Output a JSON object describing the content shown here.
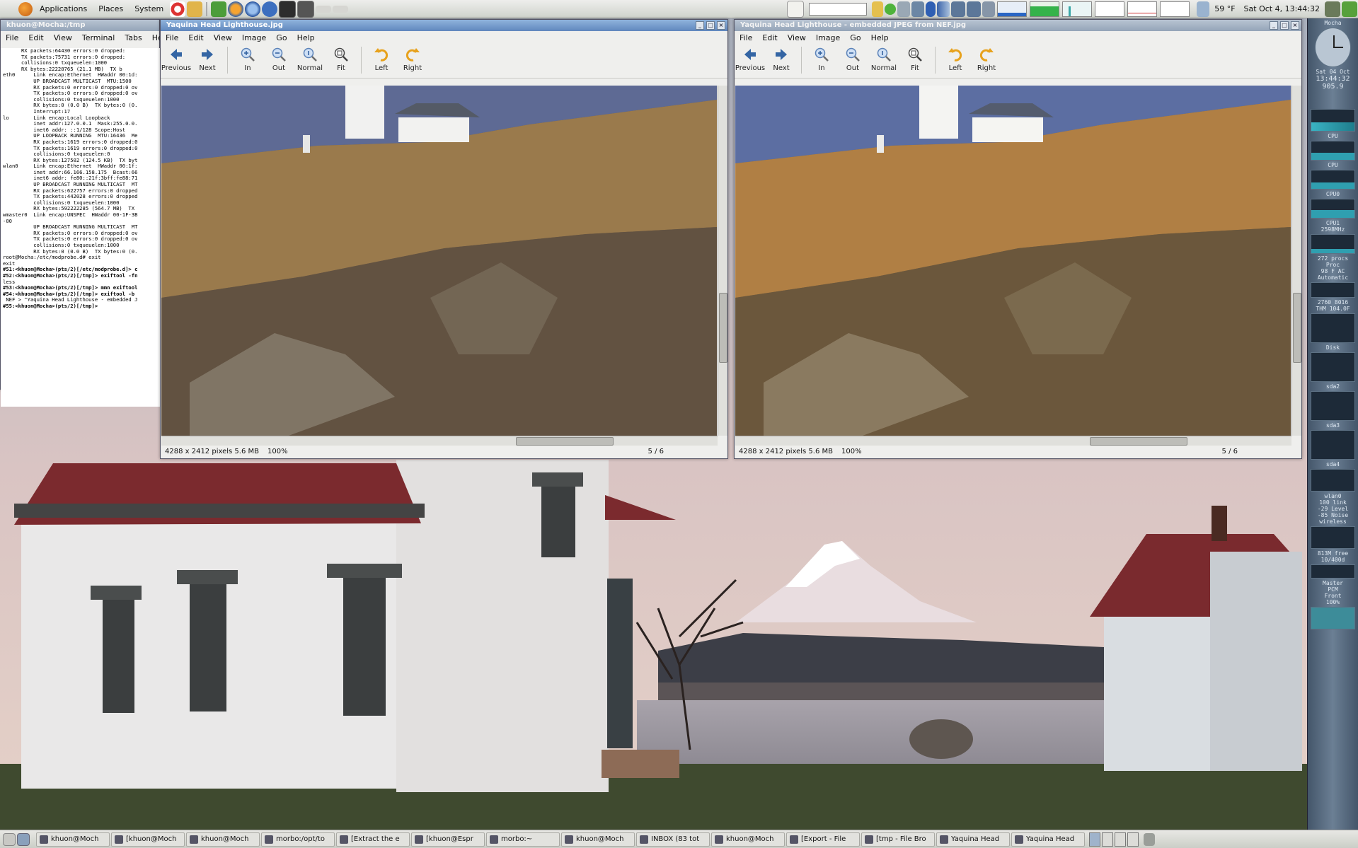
{
  "top_panel": {
    "menus": [
      "Applications",
      "Places",
      "System"
    ],
    "weather": "59 °F",
    "clock": "Sat Oct  4, 13:44:32"
  },
  "terminal": {
    "title": "khuon@Mocha:/tmp",
    "menus": [
      "File",
      "Edit",
      "View",
      "Terminal",
      "Tabs",
      "Help"
    ],
    "lines": [
      "      RX packets:64430 errors:0 dropped:",
      "      TX packets:75731 errors:0 dropped:",
      "      collisions:0 txqueuelen:1000",
      "      RX bytes:22228765 (21.1 MB)  TX b",
      "",
      "eth0      Link encap:Ethernet  HWaddr 00:1d:",
      "          UP BROADCAST MULTICAST  MTU:1500",
      "          RX packets:0 errors:0 dropped:0 ov",
      "          TX packets:0 errors:0 dropped:0 ov",
      "          collisions:0 txqueuelen:1000",
      "          RX bytes:0 (0.0 B)  TX bytes:0 (0.",
      "          Interrupt:17",
      "",
      "lo        Link encap:Local Loopback",
      "          inet addr:127.0.0.1  Mask:255.0.0.",
      "          inet6 addr: ::1/128 Scope:Host",
      "          UP LOOPBACK RUNNING  MTU:16436  Me",
      "          RX packets:1619 errors:0 dropped:0",
      "          TX packets:1619 errors:0 dropped:0",
      "          collisions:0 txqueuelen:0",
      "          RX bytes:127502 (124.5 KB)  TX byt",
      "",
      "wlan0     Link encap:Ethernet  HWaddr 00:1f:",
      "          inet addr:66.166.158.175  Bcast:66",
      "          inet6 addr: fe80::21f:3bff:fe88:71",
      "          UP BROADCAST RUNNING MULTICAST  MT",
      "          RX packets:622757 errors:0 dropped",
      "          TX packets:442028 errors:0 dropped",
      "          collisions:0 txqueuelen:1000",
      "          RX bytes:592222285 (564.7 MB)  TX",
      "",
      "wmaster0  Link encap:UNSPEC  HWaddr 00-1F-3B",
      "-00",
      "          UP BROADCAST RUNNING MULTICAST  MT",
      "          RX packets:0 errors:0 dropped:0 ov",
      "          TX packets:0 errors:0 dropped:0 ov",
      "          collisions:0 txqueuelen:1000",
      "          RX bytes:0 (0.0 B)  TX bytes:0 (0.",
      "",
      "root@Mocha:/etc/modprobe.d# exit",
      "exit",
      "#51:<khuon@Mocha>(pts/2)[/etc/modprobe.d]> c",
      "#52:<khuon@Mocha>(pts/2)[/tmp]> exiftool -fn",
      "less",
      "#53:<khuon@Mocha>(pts/2)[/tmp]> mmn exiftool",
      "#54:<khuon@Mocha>(pts/2)[/tmp]> exiftool -b",
      " NEF > \"Yaquina Head Lighthouse - embedded J",
      "#55:<khuon@Mocha>(pts/2)[/tmp]> "
    ]
  },
  "viewer_left": {
    "title": "Yaquina Head Lighthouse.jpg",
    "menus": [
      "File",
      "Edit",
      "View",
      "Image",
      "Go",
      "Help"
    ],
    "toolbar": [
      "Previous",
      "Next",
      "In",
      "Out",
      "Normal",
      "Fit",
      "Left",
      "Right"
    ],
    "status_dims": "4288 x 2412 pixels  5.6 MB",
    "status_zoom": "100%",
    "status_index": "5 / 6"
  },
  "viewer_right": {
    "title": "Yaquina Head Lighthouse - embedded JPEG from NEF.jpg",
    "menus": [
      "File",
      "Edit",
      "View",
      "Image",
      "Go",
      "Help"
    ],
    "toolbar": [
      "Previous",
      "Next",
      "In",
      "Out",
      "Normal",
      "Fit",
      "Left",
      "Right"
    ],
    "status_dims": "4288 x 2412 pixels  5.6 MB",
    "status_zoom": "100%",
    "status_index": "5 / 6"
  },
  "gkrellm": {
    "host": "Mocha",
    "time": "13:44:32",
    "date": "Sat 04 Oct",
    "pressure": "905.9",
    "labels": [
      "CPU",
      "CPU",
      "CPU0",
      "CPU1",
      "2598MHz",
      "272 procs",
      "Proc",
      "98 F AC",
      "Automatic",
      "2760",
      "8016",
      "THM",
      "104.0F",
      "Disk",
      "sda2",
      "sda3",
      "sda4",
      "wlan0",
      "100 link",
      "-29 Level",
      "-85 Noise",
      "wireless",
      "813M free",
      "10/400d",
      "Master",
      "PCM",
      "Front",
      "100%"
    ]
  },
  "taskbar": {
    "tasks": [
      "khuon@Moch",
      "[khuon@Moch",
      "khuon@Moch",
      "morbo:/opt/to",
      "[Extract the e",
      "[khuon@Espr",
      "morbo:~",
      "khuon@Moch",
      "INBOX (83 tot",
      "khuon@Moch",
      "[Export - File",
      "[tmp - File Bro",
      "Yaquina Head",
      "Yaquina Head"
    ]
  }
}
